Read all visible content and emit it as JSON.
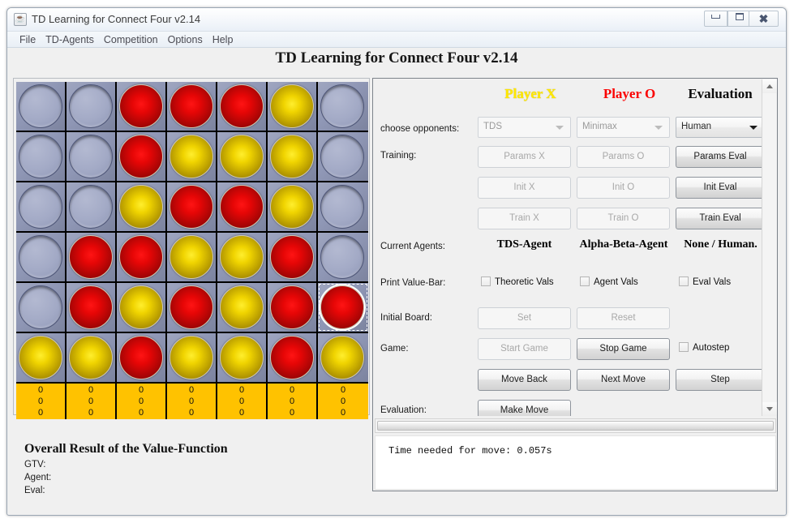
{
  "window": {
    "title": "TD Learning for Connect Four v2.14",
    "app_icon": "java-coffee-icon",
    "minimize": "–",
    "maximize": "□",
    "close": "✕"
  },
  "menubar": {
    "items": [
      {
        "label": "File"
      },
      {
        "label": "TD-Agents"
      },
      {
        "label": "Competition"
      },
      {
        "label": "Options"
      },
      {
        "label": "Help"
      }
    ]
  },
  "page_title": "TD Learning for Connect Four v2.14",
  "board": {
    "rows": 6,
    "cols": 7,
    "legend": {
      "empty": "empty",
      "red": "red",
      "yellow": "yellow"
    },
    "selected_cell": {
      "row": 4,
      "col": 6
    },
    "cells": [
      [
        "empty",
        "empty",
        "red",
        "red",
        "red",
        "yellow",
        "empty"
      ],
      [
        "empty",
        "empty",
        "red",
        "yellow",
        "yellow",
        "yellow",
        "empty"
      ],
      [
        "empty",
        "empty",
        "yellow",
        "red",
        "red",
        "yellow",
        "empty"
      ],
      [
        "empty",
        "red",
        "red",
        "yellow",
        "yellow",
        "red",
        "empty"
      ],
      [
        "empty",
        "red",
        "yellow",
        "red",
        "yellow",
        "red",
        "red"
      ],
      [
        "yellow",
        "yellow",
        "red",
        "yellow",
        "yellow",
        "red",
        "yellow"
      ]
    ],
    "value_bar": {
      "bg_color": "#ffc200",
      "columns": [
        [
          "0",
          "0",
          "0"
        ],
        [
          "0",
          "0",
          "0"
        ],
        [
          "0",
          "0",
          "0"
        ],
        [
          "0",
          "0",
          "0"
        ],
        [
          "0",
          "0",
          "0"
        ],
        [
          "0",
          "0",
          "0"
        ],
        [
          "0",
          "0",
          "0"
        ]
      ]
    }
  },
  "result": {
    "title": "Overall Result of the Value-Function",
    "lines": "GTV:\nAgent:\nEval:"
  },
  "panel": {
    "headings": {
      "player_x": "Player X",
      "player_o": "Player O",
      "evaluation": "Evaluation",
      "player_x_color": "#ffe800",
      "player_o_color": "#fa0000",
      "evaluation_color": "#0a0a0a"
    },
    "rows": {
      "choose_opponents": "choose opponents:",
      "training": "Training:",
      "current_agents": "Current Agents:",
      "print_value_bar": "Print Value-Bar:",
      "initial_board": "Initial Board:",
      "game": "Game:",
      "evaluation": "Evaluation:"
    },
    "combos": {
      "x": {
        "value": "TDS",
        "enabled": false
      },
      "o": {
        "value": "Minimax",
        "enabled": false
      },
      "eval": {
        "value": "Human",
        "enabled": true
      }
    },
    "buttons": {
      "params_x": {
        "label": "Params X",
        "enabled": false
      },
      "params_o": {
        "label": "Params O",
        "enabled": false
      },
      "params_eval": {
        "label": "Params Eval",
        "enabled": true
      },
      "init_x": {
        "label": "Init X",
        "enabled": false
      },
      "init_o": {
        "label": "Init O",
        "enabled": false
      },
      "init_eval": {
        "label": "Init Eval",
        "enabled": true
      },
      "train_x": {
        "label": "Train X",
        "enabled": false
      },
      "train_o": {
        "label": "Train O",
        "enabled": false
      },
      "train_eval": {
        "label": "Train Eval",
        "enabled": true
      },
      "set": {
        "label": "Set",
        "enabled": false
      },
      "reset": {
        "label": "Reset",
        "enabled": false
      },
      "start_game": {
        "label": "Start Game",
        "enabled": false
      },
      "stop_game": {
        "label": "Stop Game",
        "enabled": true
      },
      "move_back": {
        "label": "Move Back",
        "enabled": true
      },
      "next_move": {
        "label": "Next Move",
        "enabled": true
      },
      "step": {
        "label": "Step",
        "enabled": true
      },
      "make_move": {
        "label": "Make Move",
        "enabled": true
      }
    },
    "agents": {
      "x": "TDS-Agent",
      "o": "Alpha-Beta-Agent",
      "eval": "None / Human."
    },
    "checkboxes": {
      "theoretic_vals": {
        "label": "Theoretic Vals",
        "checked": false
      },
      "agent_vals": {
        "label": "Agent Vals",
        "checked": false
      },
      "eval_vals": {
        "label": "Eval Vals",
        "checked": false
      },
      "autostep": {
        "label": "Autostep",
        "checked": false
      }
    }
  },
  "log": {
    "text": "Time needed for move: 0.057s"
  }
}
